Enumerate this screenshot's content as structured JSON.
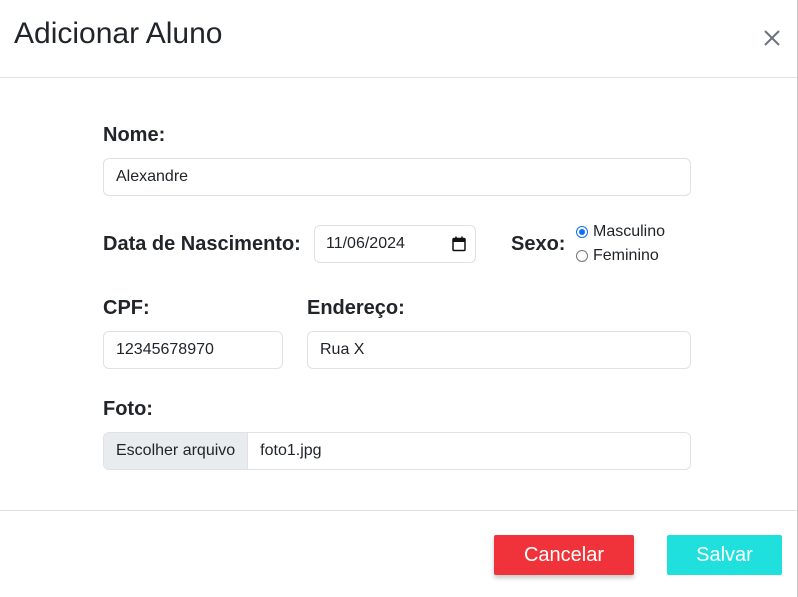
{
  "modal": {
    "title": "Adicionar Aluno",
    "close_icon": "close-icon"
  },
  "form": {
    "nome": {
      "label": "Nome:",
      "value": "Alexandre"
    },
    "data_nascimento": {
      "label": "Data de Nascimento:",
      "value": "11/06/2024",
      "icon": "calendar-icon"
    },
    "sexo": {
      "label": "Sexo:",
      "options": [
        {
          "label": "Masculino",
          "checked": true
        },
        {
          "label": "Feminino",
          "checked": false
        }
      ]
    },
    "cpf": {
      "label": "CPF:",
      "value": "12345678970"
    },
    "endereco": {
      "label": "Endereço:",
      "value": "Rua X"
    },
    "foto": {
      "label": "Foto:",
      "button_label": "Escolher arquivo",
      "file_name": "foto1.jpg"
    }
  },
  "footer": {
    "cancel_label": "Cancelar",
    "save_label": "Salvar"
  },
  "colors": {
    "cancel": "#f0333a",
    "save": "#1fe0dc",
    "radio_checked": "#0d6efd"
  }
}
